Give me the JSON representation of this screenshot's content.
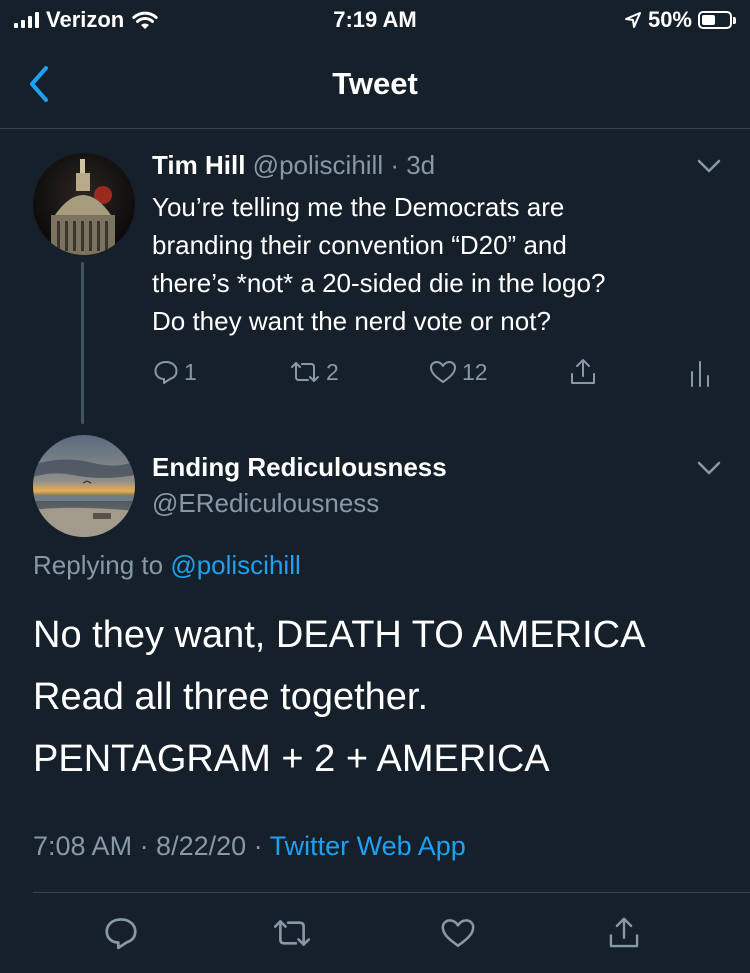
{
  "status_bar": {
    "carrier": "Verizon",
    "time": "7:19 AM",
    "battery": "50%",
    "battery_level": 0.5,
    "icons": [
      "signal-icon",
      "wifi-icon",
      "location-arrow-icon",
      "battery-icon"
    ]
  },
  "nav": {
    "title": "Tweet",
    "back_icon": "chevron-left-icon"
  },
  "parent_tweet": {
    "name": "Tim Hill",
    "handle": "@poliscihill",
    "time": "· 3d",
    "lines": [
      "You’re telling me the Democrats are",
      "branding their convention “D20” and",
      "there’s *not* a 20-sided die in the logo?",
      "Do they want the nerd vote or not?"
    ],
    "counts": {
      "replies": "1",
      "retweets": "2",
      "likes": "12"
    }
  },
  "main_tweet": {
    "name": "Ending Rediculousness",
    "handle": "@ERediculousness",
    "replying_to_label": "Replying to",
    "replying_to_handle": "@poliscihill",
    "lines": [
      "No they want, DEATH TO AMERICA",
      "Read all three together.",
      "PENTAGRAM + 2 + AMERICA"
    ],
    "timestamp": "7:08 AM · 8/22/20 ·",
    "source": "Twitter Web App"
  },
  "colors": {
    "background": "#15202b",
    "accent": "#1da1f2",
    "muted": "#8899a6",
    "divider": "#38444d"
  }
}
